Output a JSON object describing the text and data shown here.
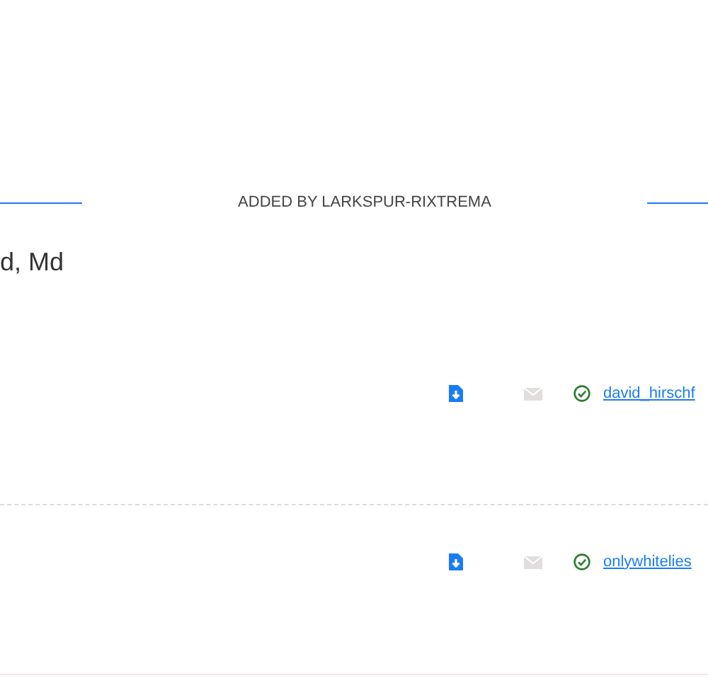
{
  "section_heading": "ADDED BY LARKSPUR-RIXTREMA",
  "name_text": "d, Md",
  "entries": [
    {
      "email_disabled": true,
      "verified": true,
      "user_link": "david_hirschf"
    },
    {
      "email_disabled": true,
      "verified": true,
      "user_link": "onlywhitelies"
    }
  ]
}
